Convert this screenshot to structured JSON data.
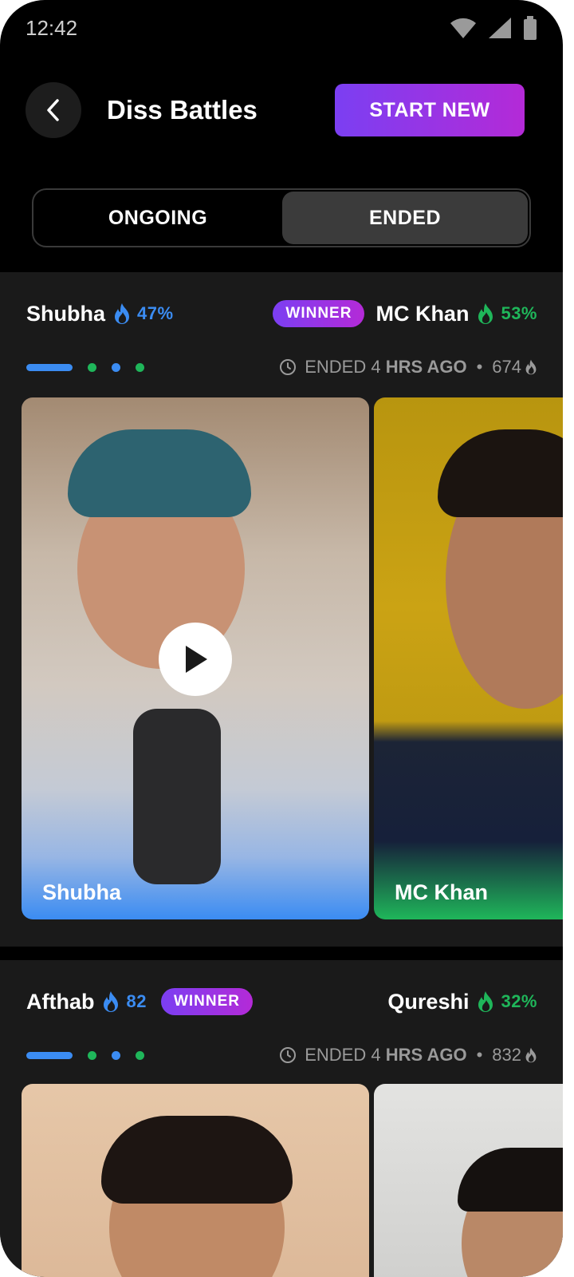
{
  "status": {
    "time": "12:42"
  },
  "header": {
    "title": "Diss Battles",
    "start_label": "START NEW"
  },
  "tabs": [
    {
      "label": "ONGOING",
      "active": false
    },
    {
      "label": "ENDED",
      "active": true
    }
  ],
  "colors": {
    "accent_gradient_start": "#7b3ff2",
    "accent_gradient_end": "#b42ad7",
    "blue": "#3b8cf2",
    "green": "#1fb65a"
  },
  "battles": [
    {
      "left": {
        "name": "Shubha",
        "score": "47%"
      },
      "right": {
        "name": "MC Khan",
        "score": "53%"
      },
      "winner_label": "WINNER",
      "winner_side": "right",
      "ended_prefix": "ENDED 4",
      "ended_suffix": "HRS AGO",
      "count": "674",
      "videos": {
        "left_name": "Shubha",
        "right_name": "MC Khan"
      }
    },
    {
      "left": {
        "name": "Afthab",
        "score": "82"
      },
      "right": {
        "name": "Qureshi",
        "score": "32%"
      },
      "winner_label": "WINNER",
      "winner_side": "left",
      "ended_prefix": "ENDED 4",
      "ended_suffix": "HRS AGO",
      "count": "832"
    }
  ]
}
